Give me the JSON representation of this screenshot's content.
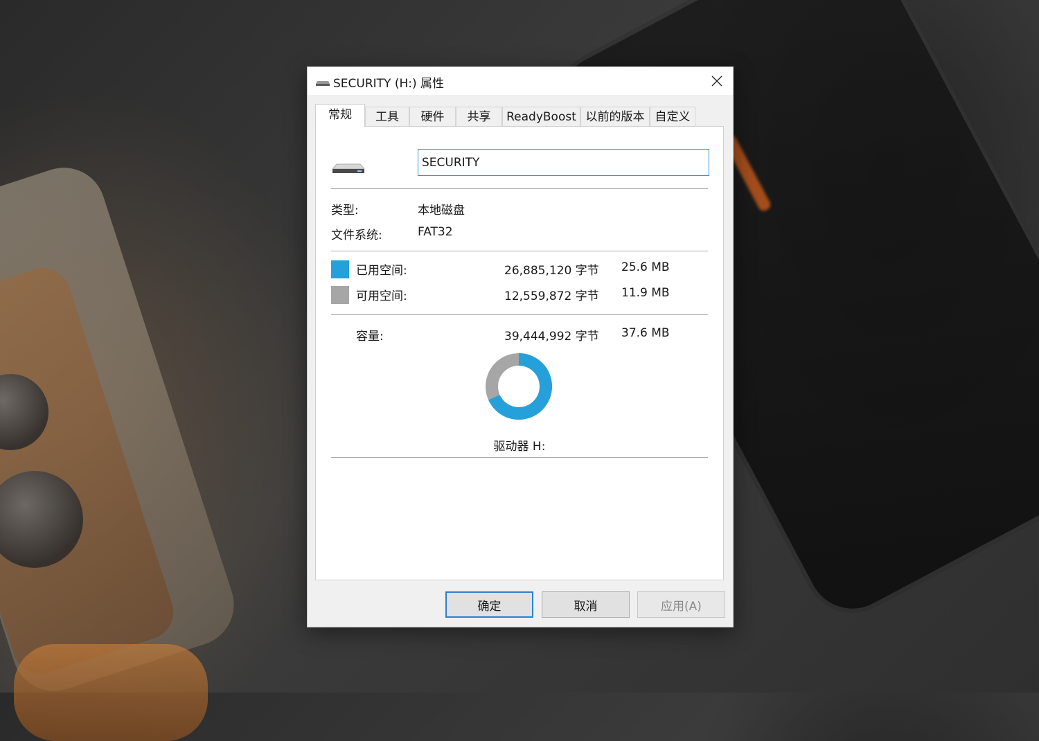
{
  "window": {
    "title": "SECURITY (H:) 属性",
    "title_icon": "drive-icon",
    "close_icon": "close-icon"
  },
  "tabs": [
    {
      "label": "常规",
      "active": true
    },
    {
      "label": "工具"
    },
    {
      "label": "硬件"
    },
    {
      "label": "共享"
    },
    {
      "label": "ReadyBoost"
    },
    {
      "label": "以前的版本"
    },
    {
      "label": "自定义"
    }
  ],
  "general": {
    "volume_name": "SECURITY",
    "type_label": "类型:",
    "type_value": "本地磁盘",
    "fs_label": "文件系统:",
    "fs_value": "FAT32",
    "used_label": "已用空间:",
    "used_bytes": "26,885,120 字节",
    "used_size": "25.6 MB",
    "free_label": "可用空间:",
    "free_bytes": "12,559,872 字节",
    "free_size": "11.9 MB",
    "capacity_label": "容量:",
    "capacity_bytes": "39,444,992 字节",
    "capacity_size": "37.6 MB",
    "used_fraction": 0.682,
    "drive_label": "驱动器 H:"
  },
  "colors": {
    "used": "#26a0da",
    "free": "#a6a6a6"
  },
  "buttons": {
    "ok": "确定",
    "cancel": "取消",
    "apply": "应用(A)"
  }
}
